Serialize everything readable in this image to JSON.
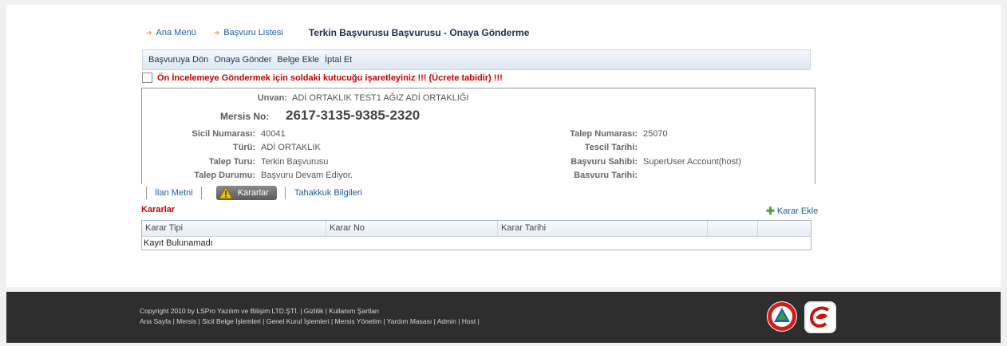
{
  "nav": {
    "ana_menu": "Ana Menü",
    "basvuru_listesi": "Başvuru Listesi",
    "page_title": "Terkin Başvurusu Başvurusu - Onaya Gönderme"
  },
  "actions": [
    "Başvuruya Dön",
    "Onaya Gönder",
    "Belge Ekle",
    "İptal Et"
  ],
  "warning": "Ön İncelemeye Göndermek için soldaki kutucuğu işaretleyiniz !!! (Ücrete tabidir) !!!",
  "info": {
    "unvan_label": "Unvan:",
    "unvan_value": "ADİ ORTAKLIK TEST1 AĞIZ ADİ ORTAKLIĞI",
    "mersis_label": "Mersis No:",
    "mersis_value": "2617-3135-9385-2320",
    "sicil_label": "Sicil Numarası:",
    "sicil_value": "40041",
    "turu_label": "Türü:",
    "turu_value": "ADİ ORTAKLIK",
    "talep_turu_label": "Talep Turu:",
    "talep_turu_value": "Terkin Başvurusu",
    "talep_durumu_label": "Talep Durumu:",
    "talep_durumu_value": "Başvuru Devam Ediyor.",
    "talep_no_label": "Talep Numarası:",
    "talep_no_value": "25070",
    "tescil_label": "Tescil Tarihi:",
    "tescil_value": "",
    "sahibi_label": "Başvuru Sahibi:",
    "sahibi_value": "SuperUser Account(host)",
    "basvuru_tarihi_label": "Basvuru Tarihi:",
    "basvuru_tarihi_value": ""
  },
  "tabs": {
    "ilan": "İlan Metni",
    "kararlar": "Kararlar",
    "tahakkuk": "Tahakkuk Bilgileri"
  },
  "kararlar": {
    "title": "Kararlar",
    "add_label": "Karar Ekle",
    "columns": [
      "Karar Tipi",
      "Karar No",
      "Karar Tarihi"
    ],
    "empty": "Kayıt Bulunamadı"
  },
  "footer": {
    "copyright": "Copyright 2010 by LSPro Yazılım ve Bilişim LTD.ŞTİ. | Gizlilik | Kullanım Şartları",
    "links": "Ana Sayfa | Mersis | Sicil Belge İşlemleri | Genel Kurul İşlemleri | Mersis Yönetim | Yardım Masası | Admin | Host |"
  },
  "colors": {
    "accent": "#1a5fa0",
    "warning": "#cc0000",
    "footer_bg": "#2e2e2e"
  }
}
